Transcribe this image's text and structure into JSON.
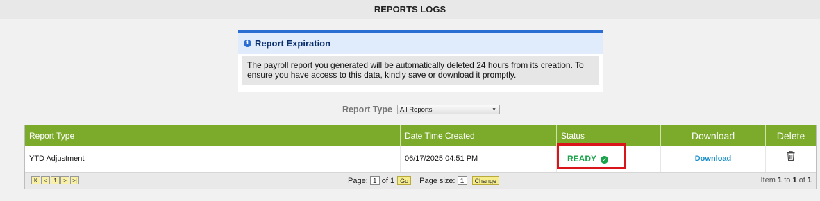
{
  "header": {
    "title": "REPORTS LOGS"
  },
  "notice": {
    "title": "Report Expiration",
    "icon": "info-icon",
    "message": "The payroll report you generated will be automatically deleted 24 hours from its creation. To ensure you have access to this data, kindly save or download it promptly."
  },
  "filter": {
    "label": "Report Type",
    "selected": "All Reports"
  },
  "table": {
    "columns": [
      "Report Type",
      "Date Time Created",
      "Status",
      "Download",
      "Delete"
    ],
    "rows": [
      {
        "report_type": "YTD Adjustment",
        "created": "06/17/2025 04:51 PM",
        "status": "READY",
        "download": "Download",
        "delete_icon": "trash-icon"
      }
    ]
  },
  "pager": {
    "first": "K",
    "prev": "<",
    "current": "1",
    "next": ">",
    "last": ">|",
    "page_label": "Page:",
    "page_value": "1",
    "of_label": "of 1",
    "go_label": "Go",
    "size_label": "Page size:",
    "size_value": "1",
    "change_label": "Change",
    "item_prefix": "Item",
    "item_from": "1",
    "item_to_label": "to",
    "item_to": "1",
    "item_of_label": "of",
    "item_total": "1"
  },
  "colors": {
    "grid_header": "#7cab2c",
    "ready": "#1aa34a",
    "highlight": "#d9141b",
    "notice_border": "#2a6dd3"
  }
}
